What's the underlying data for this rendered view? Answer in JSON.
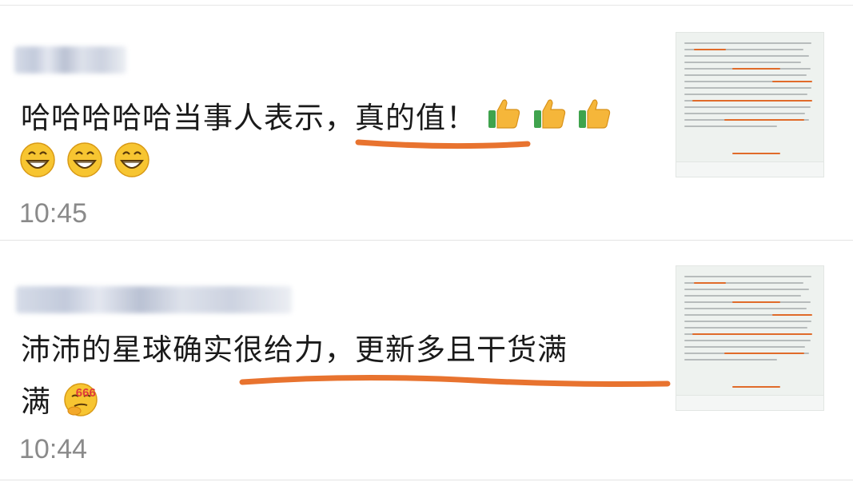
{
  "comments": [
    {
      "text_main": "哈哈哈哈哈当事人表示，真的值！",
      "reaction_icons": [
        "thumbs-up-icon",
        "thumbs-up-icon",
        "thumbs-up-icon"
      ],
      "trailing_icons": [
        "grinning-face-icon",
        "grinning-face-icon",
        "grinning-face-icon"
      ],
      "time": "10:45"
    },
    {
      "text_line1": "沛沛的星球确实很给力，更新多且干货满",
      "text_line2": "满",
      "badge": "666",
      "time": "10:44"
    }
  ],
  "colors": {
    "accent_underline": "#e8732f",
    "time": "#8a8a8a",
    "text": "#1a1a1a"
  }
}
